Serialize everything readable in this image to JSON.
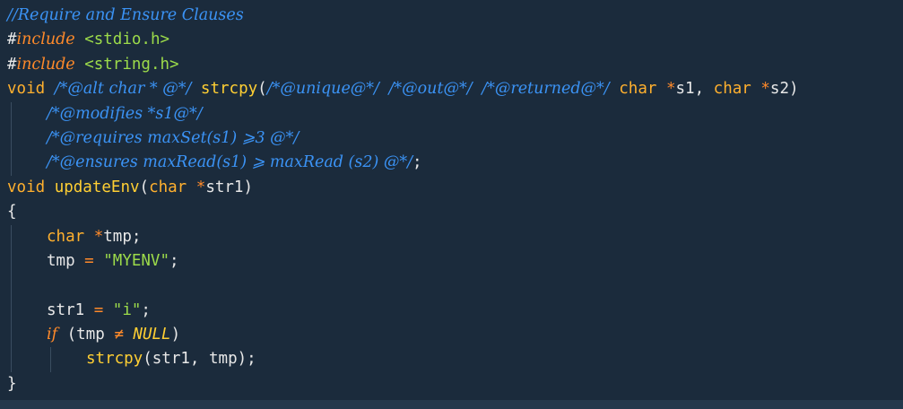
{
  "editor": {
    "colors": {
      "background": "#1b2b3c",
      "comment": "#3b93f5",
      "keyword": "#ff8a2a",
      "type": "#ffb02e",
      "function": "#ffcf33",
      "string": "#9cdb4a",
      "text": "#e8e8e8"
    },
    "lines": [
      {
        "tokens": [
          {
            "cls": "comment",
            "text": "//Require and Ensure Clauses"
          }
        ]
      },
      {
        "tokens": [
          {
            "cls": "preproc-hash",
            "text": "#"
          },
          {
            "cls": "preproc-kw",
            "text": "include"
          },
          {
            "cls": "punct",
            "text": " "
          },
          {
            "cls": "header",
            "text": "<stdio.h>"
          }
        ]
      },
      {
        "tokens": [
          {
            "cls": "preproc-hash",
            "text": "#"
          },
          {
            "cls": "preproc-kw",
            "text": "include"
          },
          {
            "cls": "punct",
            "text": " "
          },
          {
            "cls": "header",
            "text": "<string.h>"
          }
        ]
      },
      {
        "tokens": [
          {
            "cls": "type",
            "text": "void"
          },
          {
            "cls": "punct",
            "text": " "
          },
          {
            "cls": "comment",
            "text": "/*@alt char * @*/"
          },
          {
            "cls": "punct",
            "text": " "
          },
          {
            "cls": "func",
            "text": "strcpy"
          },
          {
            "cls": "punct",
            "text": "("
          },
          {
            "cls": "comment",
            "text": "/*@unique@*/"
          },
          {
            "cls": "punct",
            "text": " "
          },
          {
            "cls": "comment",
            "text": "/*@out@*/"
          },
          {
            "cls": "punct",
            "text": " "
          },
          {
            "cls": "comment",
            "text": "/*@returned@*/"
          },
          {
            "cls": "punct",
            "text": " "
          },
          {
            "cls": "type",
            "text": "char"
          },
          {
            "cls": "punct",
            "text": " "
          },
          {
            "cls": "op",
            "text": "*"
          },
          {
            "cls": "ident",
            "text": "s1"
          },
          {
            "cls": "punct",
            "text": ", "
          },
          {
            "cls": "type",
            "text": "char"
          },
          {
            "cls": "punct",
            "text": " "
          },
          {
            "cls": "op",
            "text": "*"
          },
          {
            "cls": "ident",
            "text": "s2"
          },
          {
            "cls": "punct",
            "text": ")"
          }
        ]
      },
      {
        "indent": 1,
        "tokens": [
          {
            "cls": "comment",
            "text": "/*@modifies *s1@*/"
          }
        ]
      },
      {
        "indent": 1,
        "tokens": [
          {
            "cls": "comment",
            "text": "/*@requires maxSet(s1) ⩾3 @*/"
          }
        ]
      },
      {
        "indent": 1,
        "tokens": [
          {
            "cls": "comment",
            "text": "/*@ensures maxRead(s1) ⩾ maxRead (s2) @*/"
          },
          {
            "cls": "punct",
            "text": ";"
          }
        ]
      },
      {
        "tokens": [
          {
            "cls": "type",
            "text": "void"
          },
          {
            "cls": "punct",
            "text": " "
          },
          {
            "cls": "func",
            "text": "updateEnv"
          },
          {
            "cls": "punct",
            "text": "("
          },
          {
            "cls": "type",
            "text": "char"
          },
          {
            "cls": "punct",
            "text": " "
          },
          {
            "cls": "op",
            "text": "*"
          },
          {
            "cls": "ident",
            "text": "str1"
          },
          {
            "cls": "punct",
            "text": ")"
          }
        ]
      },
      {
        "tokens": [
          {
            "cls": "punct",
            "text": "{"
          }
        ]
      },
      {
        "indent": 1,
        "tokens": [
          {
            "cls": "type",
            "text": "char"
          },
          {
            "cls": "punct",
            "text": " "
          },
          {
            "cls": "op",
            "text": "*"
          },
          {
            "cls": "ident",
            "text": "tmp"
          },
          {
            "cls": "punct",
            "text": ";"
          }
        ]
      },
      {
        "indent": 1,
        "tokens": [
          {
            "cls": "ident",
            "text": "tmp"
          },
          {
            "cls": "punct",
            "text": " "
          },
          {
            "cls": "op",
            "text": "="
          },
          {
            "cls": "punct",
            "text": " "
          },
          {
            "cls": "string",
            "text": "\"MYENV\""
          },
          {
            "cls": "punct",
            "text": ";"
          }
        ]
      },
      {
        "indent": 1,
        "tokens": []
      },
      {
        "indent": 1,
        "tokens": [
          {
            "cls": "ident",
            "text": "str1"
          },
          {
            "cls": "punct",
            "text": " "
          },
          {
            "cls": "op",
            "text": "="
          },
          {
            "cls": "punct",
            "text": " "
          },
          {
            "cls": "string",
            "text": "\"i\""
          },
          {
            "cls": "punct",
            "text": ";"
          }
        ]
      },
      {
        "indent": 1,
        "tokens": [
          {
            "cls": "kw-ctrl",
            "text": "if"
          },
          {
            "cls": "punct",
            "text": " ("
          },
          {
            "cls": "ident",
            "text": "tmp"
          },
          {
            "cls": "punct",
            "text": " "
          },
          {
            "cls": "op",
            "text": "≠"
          },
          {
            "cls": "punct",
            "text": " "
          },
          {
            "cls": "const",
            "text": "NULL"
          },
          {
            "cls": "punct",
            "text": ")"
          }
        ]
      },
      {
        "indent": 2,
        "tokens": [
          {
            "cls": "func",
            "text": "strcpy"
          },
          {
            "cls": "punct",
            "text": "("
          },
          {
            "cls": "ident",
            "text": "str1"
          },
          {
            "cls": "punct",
            "text": ", "
          },
          {
            "cls": "ident",
            "text": "tmp"
          },
          {
            "cls": "punct",
            "text": ");"
          }
        ]
      },
      {
        "tokens": [
          {
            "cls": "punct",
            "text": "}"
          }
        ]
      }
    ]
  }
}
